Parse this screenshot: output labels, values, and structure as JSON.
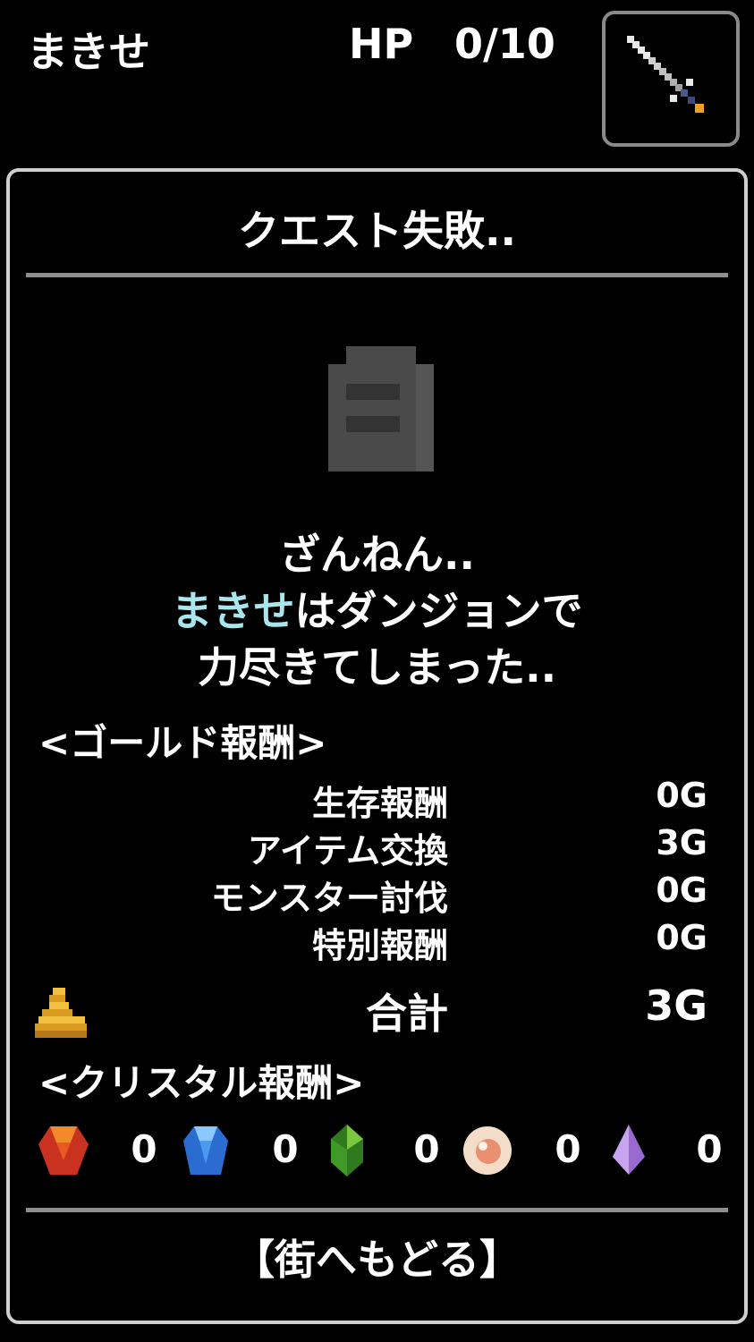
{
  "header": {
    "player_name": "まきせ",
    "hp_label": "HP",
    "hp_value": "0/10"
  },
  "panel": {
    "title": "クエスト失敗..",
    "message": {
      "line1": "ざんねん..",
      "name": "まきせ",
      "line2_rest": "はダンジョンで",
      "line3": "力尽きてしまった.."
    },
    "gold_section": "<ゴールド報酬>",
    "gold_rows": [
      {
        "label": "生存報酬",
        "value": "0G"
      },
      {
        "label": "アイテム交換",
        "value": "3G"
      },
      {
        "label": "モンスター討伐",
        "value": "0G"
      },
      {
        "label": "特別報酬",
        "value": "0G"
      }
    ],
    "total_label": "合計",
    "total_value": "3G",
    "crystal_section": "<クリスタル報酬>",
    "crystals": [
      {
        "icon": "red-crystal-icon",
        "count": "0",
        "color": "#d8402a"
      },
      {
        "icon": "blue-crystal-icon",
        "count": "0",
        "color": "#3f8ee6"
      },
      {
        "icon": "green-crystal-icon",
        "count": "0",
        "color": "#3d9a2a"
      },
      {
        "icon": "pink-crystal-icon",
        "count": "0",
        "color": "#f0b8a0"
      },
      {
        "icon": "purple-crystal-icon",
        "count": "0",
        "color": "#b08ae0"
      }
    ],
    "return_button": "【街へもどる】"
  }
}
